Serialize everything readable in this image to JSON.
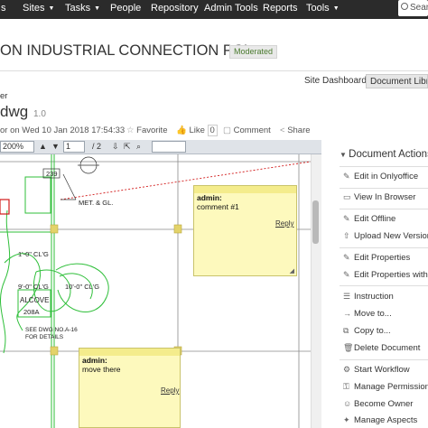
{
  "topnav": {
    "sites": "Sites",
    "tasks": "Tasks",
    "people": "People",
    "repository": "Repository",
    "admin_tools": "Admin Tools",
    "reports": "Reports",
    "tools": "Tools",
    "search_placeholder": "Sear"
  },
  "site": {
    "title": "ON INDUSTRIAL CONNECTION PCL.",
    "badge": "Moderated",
    "tab_dashboard": "Site Dashboard",
    "tab_library": "Document Libra"
  },
  "document": {
    "breadcrumb": "er",
    "name": "dwg",
    "version": "1.0",
    "modified": "or on Wed 10 Jan 2018 17:54:33",
    "favorite": "Favorite",
    "like": "Like",
    "like_count": "0",
    "comment": "Comment",
    "share": "Share"
  },
  "toolbar": {
    "zoom": "200%",
    "page": "1",
    "page_total": "/ 2"
  },
  "drawing": {
    "label_239": "239",
    "label_met": "MET. & GL.",
    "label_dim1": "1'-0\" CL'G",
    "label_dim2": "9'-0\" CL'G",
    "label_dim3": "10'-0\" CL'G",
    "label_alcove": "ALCOVE",
    "label_208a": "208A",
    "label_see": "SEE DWG NO.A-16",
    "label_for": "FOR DETAILS"
  },
  "annotations": [
    {
      "author": "admin:",
      "text": "comment #1",
      "reply": "Reply"
    },
    {
      "author": "admin:",
      "text": "move there",
      "reply": "Reply"
    }
  ],
  "actions": {
    "title": "Document Actions",
    "items": [
      "Edit in Onlyoffice",
      "View In Browser",
      "Edit Offline",
      "Upload New Version",
      "Edit Properties",
      "Edit Properties with",
      "Instruction",
      "Move to...",
      "Copy to...",
      "Delete Document",
      "Start Workflow",
      "Manage Permissions",
      "Become Owner",
      "Manage Aspects"
    ]
  },
  "colors": {
    "topbar": "#2b2b2b",
    "note": "#fdf9bd",
    "drawing_green": "#2fbf3a",
    "drawing_red": "#d21a1a"
  }
}
